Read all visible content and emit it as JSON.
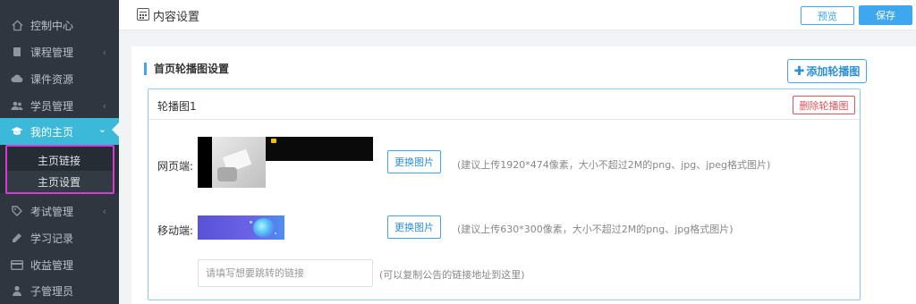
{
  "sidebar": {
    "items": [
      {
        "label": "控制中心",
        "icon": "home-icon",
        "has_chevron": false
      },
      {
        "label": "课程管理",
        "icon": "book-icon",
        "has_chevron": true
      },
      {
        "label": "课件资源",
        "icon": "cloud-icon",
        "has_chevron": false
      },
      {
        "label": "学员管理",
        "icon": "users-icon",
        "has_chevron": true
      },
      {
        "label": "我的主页",
        "icon": "graduation-cap-icon",
        "has_chevron": true,
        "active": true
      },
      {
        "label": "考试管理",
        "icon": "tag-icon",
        "has_chevron": true
      },
      {
        "label": "学习记录",
        "icon": "pencil-icon",
        "has_chevron": false
      },
      {
        "label": "收益管理",
        "icon": "card-icon",
        "has_chevron": false
      },
      {
        "label": "子管理员",
        "icon": "user-icon",
        "has_chevron": false
      }
    ],
    "submenu": [
      {
        "label": "主页链接"
      },
      {
        "label": "主页设置",
        "selected": true
      }
    ],
    "chevron_down": "⌄",
    "chevron_left": "‹"
  },
  "topbar": {
    "title": "内容设置",
    "preview_label": "预览",
    "save_label": "保存"
  },
  "main": {
    "section_title": "首页轮播图设置",
    "add_label": "添加轮播图",
    "carousel": {
      "title": "轮播图1",
      "delete_label": "删除轮播图",
      "web_label": "网页端:",
      "mobile_label": "移动端:",
      "change_label": "更换图片",
      "web_hint": "(建议上传1920*474像素，大小不超过2M的png、jpg、jpeg格式图片)",
      "mobile_hint": "(建议上传630*300像素，大小不超过2M的png、jpg格式图片)",
      "link_placeholder": "请填写想要跳转的链接",
      "link_value": "",
      "link_hint": "(可以复制公告的链接地址到这里)"
    }
  },
  "colors": {
    "accent": "#3ea7ee",
    "active_nav": "#3cb9d9",
    "danger": "#e0545a",
    "highlight": "#d63ad8",
    "sidebar_bg": "#2f3640"
  }
}
